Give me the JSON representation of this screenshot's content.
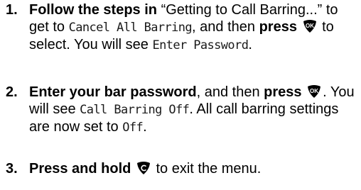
{
  "steps": [
    {
      "num": "1.",
      "t1": "Follow the steps in",
      "t2": " “Getting to Call Barring...” to get to ",
      "lcd1": "Cancel All Barring",
      "t3": ", and then ",
      "t4": "press",
      "t5": " ",
      "key": "ok-key-icon",
      "t6": " to select. You will see ",
      "lcd2": "Enter Password",
      "t7": "."
    },
    {
      "num": "2.",
      "t1": "Enter your bar password",
      "t2": ", and then ",
      "t3": "press",
      "key": "ok-key-icon",
      "t4": ". You will see ",
      "lcd1": "Call Barring Off",
      "t5": ". All call barring settings are now set to ",
      "lcd2": "Off",
      "t6": "."
    },
    {
      "num": "3.",
      "t1": "Press and hold",
      "key": "c-key-icon",
      "t2": " to exit the menu."
    }
  ],
  "keys": {
    "ok_label": "OK",
    "key_color": "#000000"
  }
}
